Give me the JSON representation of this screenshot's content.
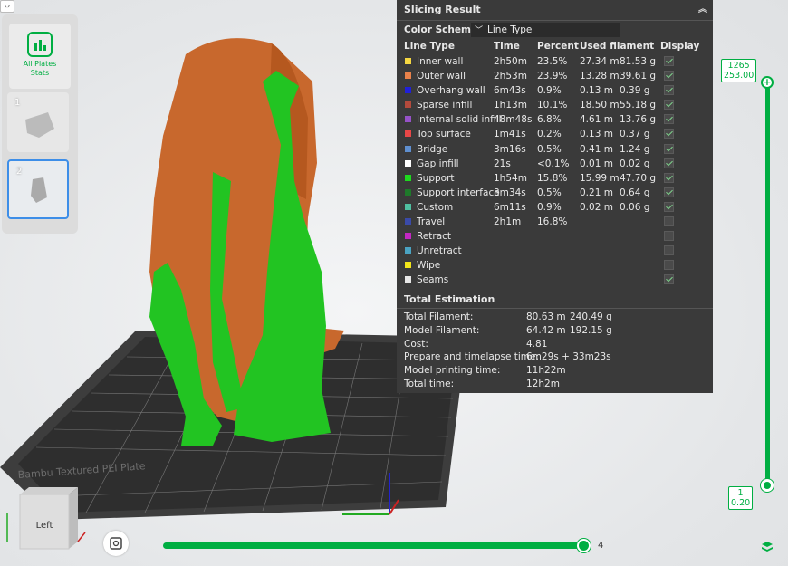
{
  "sidebar": {
    "stats_label_1": "All Plates",
    "stats_label_2": "Stats",
    "plates": [
      {
        "num": "1"
      },
      {
        "num": "2"
      }
    ]
  },
  "panel": {
    "title": "Slicing Result",
    "color_scheme_label": "Color Scheme",
    "color_scheme_value": "Line Type",
    "headers": {
      "type": "Line Type",
      "time": "Time",
      "percent": "Percent",
      "filament": "Used filament",
      "display": "Display"
    },
    "rows": [
      {
        "name": "Inner wall",
        "color": "#f5d742",
        "time": "2h50m",
        "percent": "23.5%",
        "length": "27.34 m",
        "grams": "81.53 g",
        "display": true
      },
      {
        "name": "Outer wall",
        "color": "#e8814a",
        "time": "2h53m",
        "percent": "23.9%",
        "length": "13.28 m",
        "grams": "39.61 g",
        "display": true
      },
      {
        "name": "Overhang wall",
        "color": "#2020d8",
        "time": "6m43s",
        "percent": "0.9%",
        "length": "0.13 m",
        "grams": "0.39 g",
        "display": true
      },
      {
        "name": "Sparse infill",
        "color": "#b34a3c",
        "time": "1h13m",
        "percent": "10.1%",
        "length": "18.50 m",
        "grams": "55.18 g",
        "display": true
      },
      {
        "name": "Internal solid infill",
        "color": "#9652c7",
        "time": "48m48s",
        "percent": "6.8%",
        "length": "4.61 m",
        "grams": "13.76 g",
        "display": true
      },
      {
        "name": "Top surface",
        "color": "#e84747",
        "time": "1m41s",
        "percent": "0.2%",
        "length": "0.13 m",
        "grams": "0.37 g",
        "display": true
      },
      {
        "name": "Bridge",
        "color": "#5f8fcf",
        "time": "3m16s",
        "percent": "0.5%",
        "length": "0.41 m",
        "grams": "1.24 g",
        "display": true
      },
      {
        "name": "Gap infill",
        "color": "#ffffff",
        "time": "21s",
        "percent": "<0.1%",
        "length": "0.01 m",
        "grams": "0.02 g",
        "display": true
      },
      {
        "name": "Support",
        "color": "#1ed91e",
        "time": "1h54m",
        "percent": "15.8%",
        "length": "15.99 m",
        "grams": "47.70 g",
        "display": true
      },
      {
        "name": "Support interface",
        "color": "#1e7a2a",
        "time": "3m34s",
        "percent": "0.5%",
        "length": "0.21 m",
        "grams": "0.64 g",
        "display": true
      },
      {
        "name": "Custom",
        "color": "#4fbfa0",
        "time": "6m11s",
        "percent": "0.9%",
        "length": "0.02 m",
        "grams": "0.06 g",
        "display": true
      },
      {
        "name": "Travel",
        "color": "#3a4aa8",
        "time": "2h1m",
        "percent": "16.8%",
        "length": "",
        "grams": "",
        "display": false
      },
      {
        "name": "Retract",
        "color": "#c227c2",
        "time": "",
        "percent": "",
        "length": "",
        "grams": "",
        "display": false
      },
      {
        "name": "Unretract",
        "color": "#4aa3c2",
        "time": "",
        "percent": "",
        "length": "",
        "grams": "",
        "display": false
      },
      {
        "name": "Wipe",
        "color": "#f2e51a",
        "time": "",
        "percent": "",
        "length": "",
        "grams": "",
        "display": false
      },
      {
        "name": "Seams",
        "color": "#e6e6e6",
        "time": "",
        "percent": "",
        "length": "",
        "grams": "",
        "display": true
      }
    ],
    "estimation_title": "Total Estimation",
    "estimation": [
      {
        "key": "Total Filament:",
        "v1": "80.63 m",
        "v2": "240.49 g"
      },
      {
        "key": "Model Filament:",
        "v1": "64.42 m",
        "v2": "192.15 g"
      },
      {
        "key": "Cost:",
        "v1": "4.81",
        "v2": ""
      },
      {
        "key": "Prepare and timelapse time:",
        "v1": "6m29s + 33m23s",
        "v2": ""
      },
      {
        "key": "Model printing time:",
        "v1": "11h22m",
        "v2": ""
      },
      {
        "key": "Total time:",
        "v1": "12h2m",
        "v2": ""
      }
    ]
  },
  "vslider": {
    "top_layer": "1265",
    "top_height": "253.00",
    "bottom_layer": "1",
    "bottom_height": "0.20"
  },
  "hslider": {
    "value": "4"
  },
  "plate_text": "Bambu Textured PEI Plate",
  "nav_cube": {
    "face": "Left"
  },
  "colors": {
    "accent": "#00ae42",
    "outer_wall": "#c8682d",
    "support": "#22c422"
  }
}
